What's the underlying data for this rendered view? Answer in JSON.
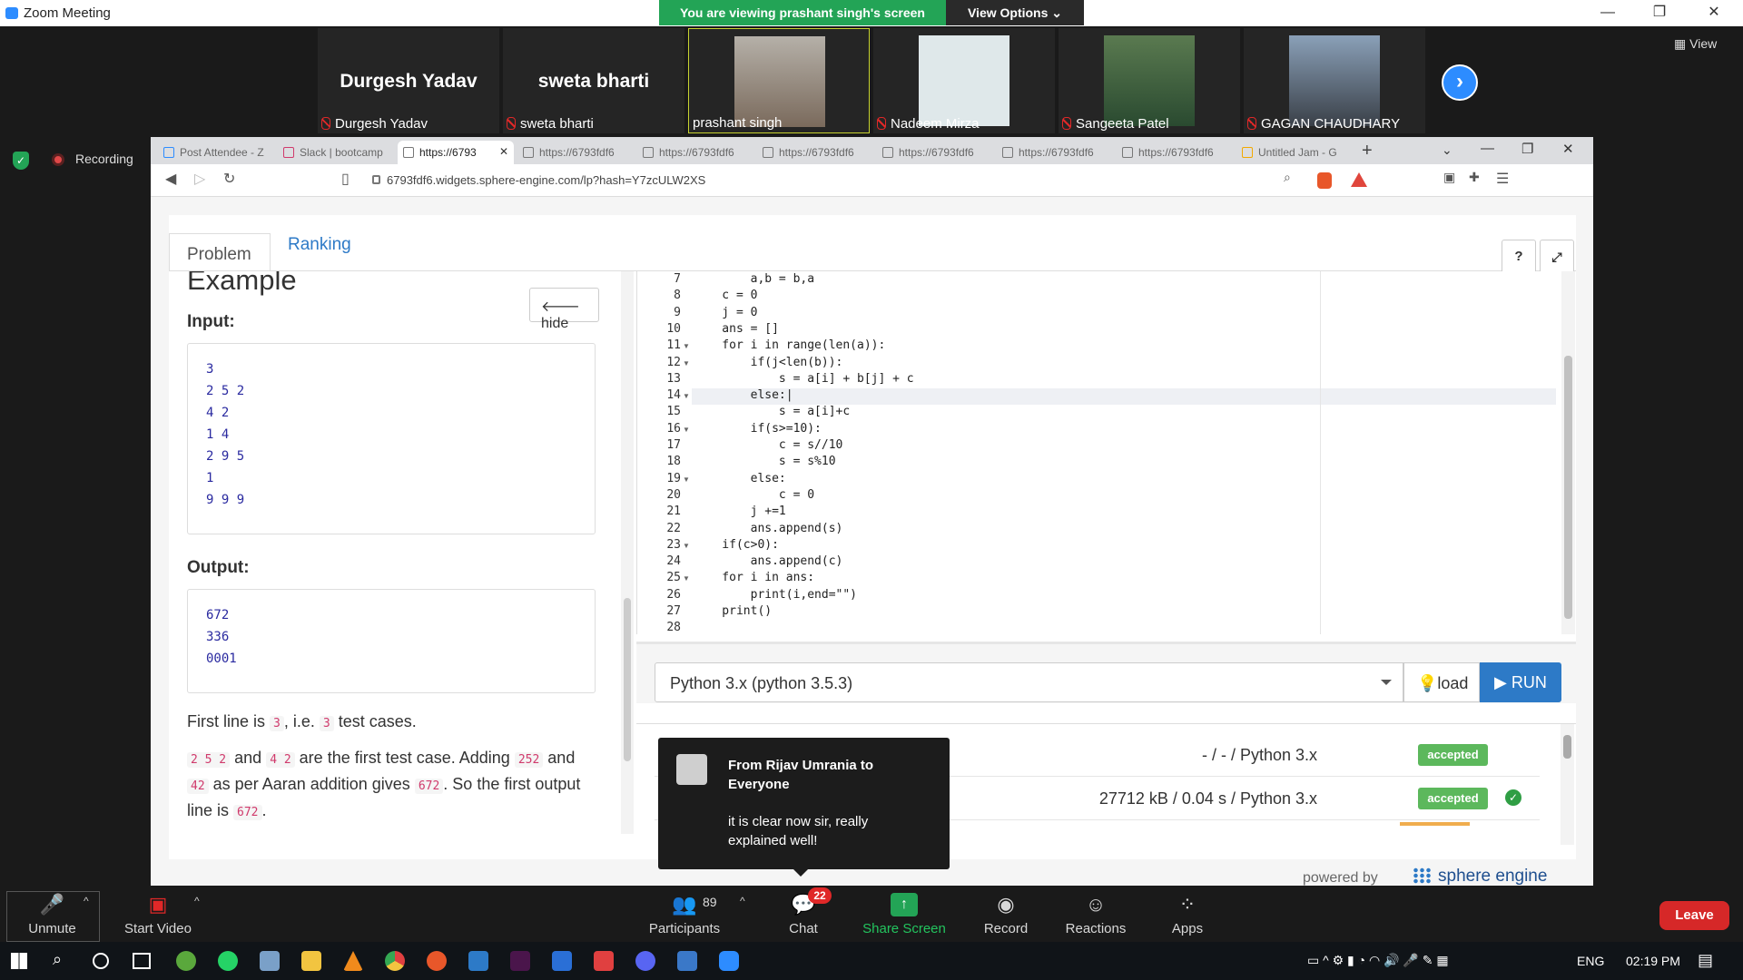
{
  "window": {
    "title": "Zoom Meeting"
  },
  "banner": {
    "viewing": "You are viewing prashant singh's screen",
    "view_options": "View Options ⌄"
  },
  "participants": [
    {
      "big_name": "Durgesh Yadav",
      "label": "Durgesh Yadav",
      "muted": true,
      "has_video": false
    },
    {
      "big_name": "sweta bharti",
      "label": "sweta bharti",
      "muted": true,
      "has_video": false
    },
    {
      "big_name": "",
      "label": "prashant singh",
      "muted": false,
      "has_video": true
    },
    {
      "big_name": "",
      "label": "Nadeem Mirza",
      "muted": true,
      "has_video": true
    },
    {
      "big_name": "",
      "label": "Sangeeta Patel",
      "muted": true,
      "has_video": true
    },
    {
      "big_name": "",
      "label": "GAGAN CHAUDHARY",
      "muted": true,
      "has_video": true
    }
  ],
  "view_label": "View",
  "recording_label": "Recording",
  "browser": {
    "tabs": [
      "Post Attendee - Z",
      "Slack | bootcamp",
      "https://6793",
      "https://6793fdf6",
      "https://6793fdf6",
      "https://6793fdf6",
      "https://6793fdf6",
      "https://6793fdf6",
      "https://6793fdf6",
      "Untitled Jam - G"
    ],
    "url": "6793fdf6.widgets.sphere-engine.com/lp?hash=Y7zcULW2XS"
  },
  "problem": {
    "tab_problem": "Problem",
    "tab_ranking": "Ranking",
    "help": "?",
    "example_title": "Example",
    "hide": "🡐 hide",
    "input_label": "Input:",
    "input_text": "3\n2 5 2\n4 2\n1 4\n2 9 5\n1\n9 9 9",
    "output_label": "Output:",
    "output_text": "672\n336\n0001",
    "para1": {
      "a": "First line is ",
      "c1": "3",
      "b": ", i.e. ",
      "c2": "3",
      "c": " test cases."
    },
    "para2": {
      "c1": "2 5 2",
      "a": " and ",
      "c2": "4 2",
      "b": " are the first test case. Adding ",
      "c3": "252",
      "c": " and ",
      "c4": "42",
      "d": " as per Aaran addition gives ",
      "c5": "672",
      "e": ". So the first output line is ",
      "c6": "672",
      "f": "."
    }
  },
  "editor": {
    "lines": [
      {
        "n": "7",
        "fold": false,
        "text": "        a,b = b,a"
      },
      {
        "n": "8",
        "fold": false,
        "text": "    c = 0"
      },
      {
        "n": "9",
        "fold": false,
        "text": "    j = 0"
      },
      {
        "n": "10",
        "fold": false,
        "text": "    ans = []"
      },
      {
        "n": "11",
        "fold": true,
        "text": "    for i in range(len(a)):"
      },
      {
        "n": "12",
        "fold": true,
        "text": "        if(j<len(b)):"
      },
      {
        "n": "13",
        "fold": false,
        "text": "            s = a[i] + b[j] + c"
      },
      {
        "n": "14",
        "fold": true,
        "text": "        else:|"
      },
      {
        "n": "15",
        "fold": false,
        "text": "            s = a[i]+c"
      },
      {
        "n": "16",
        "fold": true,
        "text": "        if(s>=10):"
      },
      {
        "n": "17",
        "fold": false,
        "text": "            c = s//10"
      },
      {
        "n": "18",
        "fold": false,
        "text": "            s = s%10"
      },
      {
        "n": "19",
        "fold": true,
        "text": "        else:"
      },
      {
        "n": "20",
        "fold": false,
        "text": "            c = 0"
      },
      {
        "n": "21",
        "fold": false,
        "text": "        j +=1"
      },
      {
        "n": "22",
        "fold": false,
        "text": "        ans.append(s)"
      },
      {
        "n": "23",
        "fold": true,
        "text": "    if(c>0):"
      },
      {
        "n": "24",
        "fold": false,
        "text": "        ans.append(c)"
      },
      {
        "n": "25",
        "fold": true,
        "text": "    for i in ans:"
      },
      {
        "n": "26",
        "fold": false,
        "text": "        print(i,end=\"\")"
      },
      {
        "n": "27",
        "fold": false,
        "text": "    print()"
      },
      {
        "n": "28",
        "fold": false,
        "text": ""
      }
    ]
  },
  "runbar": {
    "language": "Python 3.x (python 3.5.3)",
    "load": "💡load",
    "run": "▶ RUN"
  },
  "submissions": [
    {
      "info": "- / - / Python 3.x",
      "status": "accepted",
      "checked": false
    },
    {
      "info": "27712 kB / 0.04 s / Python 3.x",
      "status": "accepted",
      "checked": true
    }
  ],
  "footer": {
    "powered": "powered by",
    "brand": "sphere engine"
  },
  "toast": {
    "from": "From Rijav Umrania to Everyone",
    "message": "it is clear now sir, really explained well!"
  },
  "toolbar": {
    "unmute": "Unmute",
    "start_video": "Start Video",
    "participants": "Participants",
    "participants_count": "89",
    "chat": "Chat",
    "chat_count": "22",
    "share": "Share Screen",
    "record": "Record",
    "reactions": "Reactions",
    "apps": "Apps",
    "leave": "Leave"
  },
  "taskbar": {
    "lang": "ENG",
    "time": "02:19 PM"
  },
  "colors": {
    "zoom_blue": "#2d8cff",
    "green": "#23a456",
    "run_blue": "#2d7ac7",
    "accepted": "#5cb85c",
    "leave_red": "#d62828"
  }
}
